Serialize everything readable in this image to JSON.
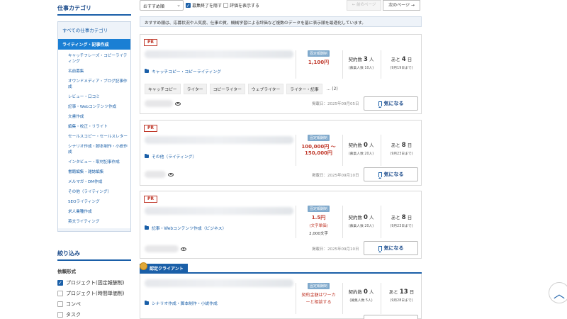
{
  "sidebar": {
    "category_heading": "仕事カテゴリ",
    "all_categories": "すべての仕事カテゴリ",
    "active_category": "ライティング・記事作成",
    "categories": [
      "キャッチフレーズ・コピーライティング",
      "名前募集",
      "オウンドメディア・ブログ記事作成",
      "レビュー・口コミ",
      "記事・Webコンテンツ作成",
      "文書作成",
      "編集・校正・リライト",
      "セールスコピー・セールスレター",
      "シナリオ作成・脚本制作・小説作成",
      "インタビュー・取材記事作成",
      "書籍編集・雑誌編集",
      "メルマガ・DM作成",
      "その他（ライティング）",
      "SEOライティング",
      "求人業種作成",
      "英文ライティング"
    ],
    "filter_heading": "絞り込み",
    "filter_subheading": "依頼形式",
    "filter_options": [
      {
        "label": "プロジェクト(固定報酬制)",
        "checked": true
      },
      {
        "label": "プロジェクト(時間単価制)",
        "checked": false
      },
      {
        "label": "コンペ",
        "checked": false
      },
      {
        "label": "タスク",
        "checked": false
      }
    ]
  },
  "toolbar": {
    "sort_value": "おすすめ順",
    "hide_closed_label": "募集終了を隠す",
    "hide_closed_checked": true,
    "show_rating_label": "評価を表示する",
    "show_rating_checked": false,
    "prev_label": "← 前のページ",
    "next_label": "次のページ →"
  },
  "notice": "おすすめ順は、応募状況や人気度、仕事の質、機械学習による評価など複数のデータを基に表示順を最適化しています。",
  "jobs": [
    {
      "badge": "PR",
      "category": "キャッチコピー・コピーライティング",
      "pay_type": "固定報酬制",
      "price": "1,100円",
      "contract_label": "契約数",
      "contract_count": "3",
      "contract_unit": "人",
      "contract_sub": "(募集人数 10人)",
      "days_prefix": "あと",
      "days": "4",
      "days_unit": "日",
      "deadline": "(9月19日まで)",
      "tags": [
        "キャッチコピー",
        "ライター",
        "コピーライター",
        "ウェブライター",
        "ライター・記事"
      ],
      "tags_more": "... (2)",
      "posted": "掲載日：2025年09月05日",
      "fav_label": "気になる"
    },
    {
      "badge": "PR",
      "category": "その他（ライティング）",
      "pay_type": "固定報酬制",
      "price_line1": "100,000円 ～",
      "price_line2": "150,000円",
      "contract_label": "契約数",
      "contract_count": "0",
      "contract_unit": "人",
      "contract_sub": "(募集人数 20人)",
      "days_prefix": "あと",
      "days": "8",
      "days_unit": "日",
      "deadline": "(9月23日まで)",
      "posted": "掲載日：2025年09月10日",
      "fav_label": "気になる"
    },
    {
      "badge": "PR",
      "category": "記事・Webコンテンツ作成（ビジネス）",
      "pay_type": "固定報酬制",
      "price": "1.5円",
      "price_note": "(文字単価)",
      "price_sub": "2,000文字",
      "contract_label": "契約数",
      "contract_count": "0",
      "contract_unit": "人",
      "contract_sub": "(募集人数 20人)",
      "days_prefix": "あと",
      "days": "8",
      "days_unit": "日",
      "deadline": "(9月23日まで)",
      "posted": "掲載日：2025年09月10日",
      "fav_label": "気になる"
    },
    {
      "banner": "認定クライアント",
      "category": "シナリオ作成・脚本制作・小説作成",
      "pay_type": "固定報酬制",
      "price_line1": "契約金額はワーカ",
      "price_line2": "ーと相談する",
      "contract_label": "契約数",
      "contract_count": "0",
      "contract_unit": "人",
      "contract_sub": "(募集人数 5人)",
      "days_prefix": "あと",
      "days": "13",
      "days_unit": "日",
      "deadline": "(9月28日まで)"
    }
  ],
  "scroll_top_icon": "chevron-up-icon"
}
